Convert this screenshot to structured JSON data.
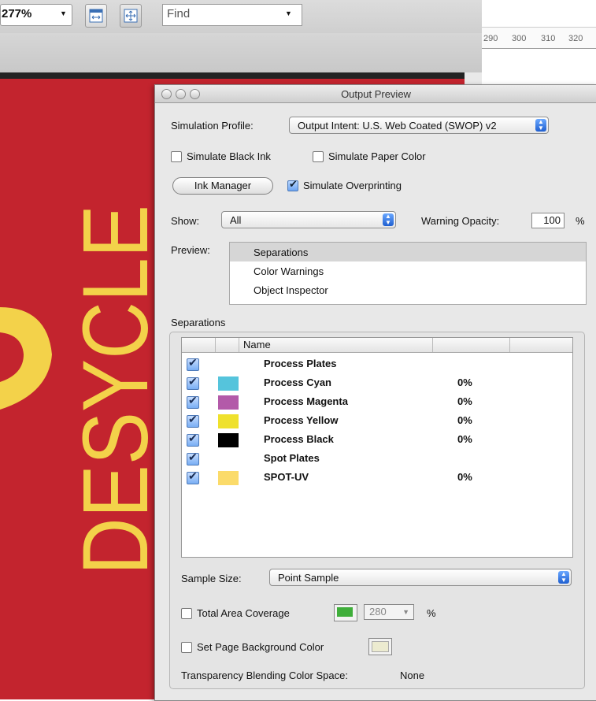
{
  "toolbar": {
    "zoom": "277%",
    "find_placeholder": "Find",
    "ruler_ticks": [
      "290",
      "300",
      "310",
      "320"
    ]
  },
  "artwork": {
    "logo_text": "DESYCLE",
    "background_color": "#c3242e",
    "logo_color": "#f3d24a"
  },
  "panel": {
    "title": "Output Preview",
    "simulation_profile_label": "Simulation Profile:",
    "simulation_profile_value": "Output Intent: U.S. Web Coated (SWOP) v2",
    "simulate_black_ink": "Simulate Black Ink",
    "simulate_paper_color": "Simulate Paper Color",
    "ink_manager": "Ink Manager",
    "simulate_overprinting": "Simulate Overprinting",
    "show_label": "Show:",
    "show_value": "All",
    "warning_opacity_label": "Warning Opacity:",
    "warning_opacity_value": "100",
    "percent": "%",
    "preview_label": "Preview:",
    "preview_items": [
      "Separations",
      "Color Warnings",
      "Object Inspector"
    ],
    "separations_group": "Separations",
    "table_header_name": "Name",
    "separations": [
      {
        "name": "Process Plates",
        "percent": "",
        "color": ""
      },
      {
        "name": "Process Cyan",
        "percent": "0%",
        "color": "#55c4dc"
      },
      {
        "name": "Process Magenta",
        "percent": "0%",
        "color": "#b35aa9"
      },
      {
        "name": "Process Yellow",
        "percent": "0%",
        "color": "#efe12c"
      },
      {
        "name": "Process Black",
        "percent": "0%",
        "color": "#000000"
      },
      {
        "name": "Spot Plates",
        "percent": "",
        "color": ""
      },
      {
        "name": "SPOT-UV",
        "percent": "0%",
        "color": "#fbdb6a"
      }
    ],
    "sample_size_label": "Sample Size:",
    "sample_size_value": "Point Sample",
    "total_area_coverage": "Total Area Coverage",
    "total_area_value": "280",
    "total_area_color": "#3fae3a",
    "set_page_bg": "Set Page Background Color",
    "page_bg_color": "#ecebd0",
    "transparency_label": "Transparency Blending Color Space:",
    "transparency_value": "None"
  }
}
